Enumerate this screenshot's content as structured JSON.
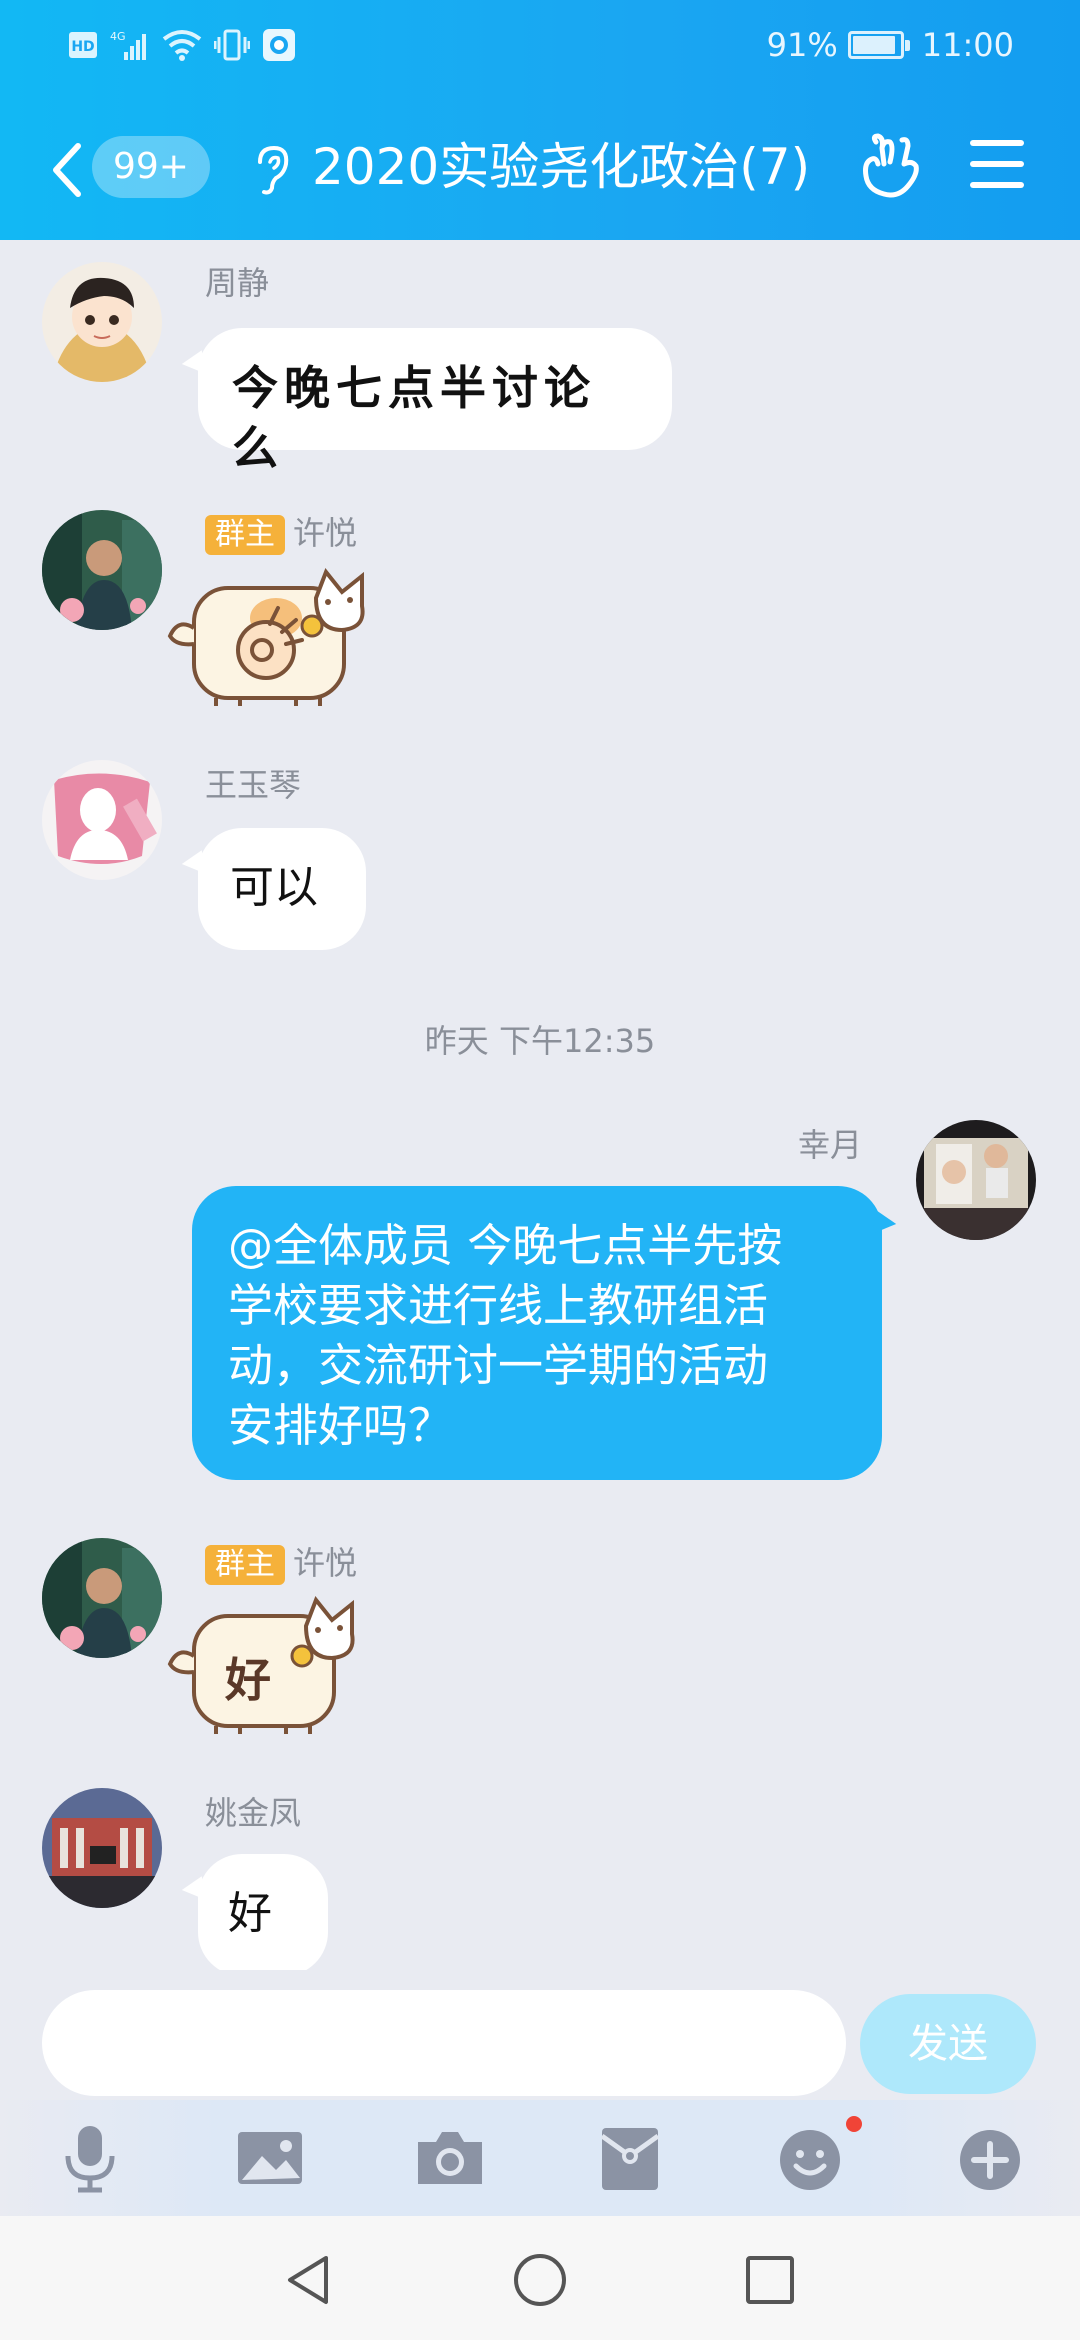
{
  "status_bar": {
    "left_icons": [
      "hd-icon",
      "4g-signal-icon",
      "wifi-icon",
      "vibrate-icon",
      "app-notification-icon"
    ],
    "hd_label": "HD",
    "network_label": "4G",
    "battery_percent": "91%",
    "time": "11:00"
  },
  "header": {
    "unread_badge": "99+",
    "title": "2020实验尧化政治(7)",
    "colors": {
      "gradient_start": "#12b8f4",
      "gradient_end": "#139df0"
    }
  },
  "messages": [
    {
      "sender": "周静",
      "text": "今晚七点半讨论么",
      "side": "left",
      "type": "text"
    },
    {
      "sender": "许悦",
      "badge": "群主",
      "side": "left",
      "type": "sticker",
      "sticker": "cat-ok-hand-sticker"
    },
    {
      "sender": "王玉琴",
      "text": "可以",
      "side": "left",
      "type": "text"
    },
    {
      "timestamp": "昨天 下午12:35"
    },
    {
      "sender": "幸月",
      "text": "@全体成员 今晚七点半先按学校要求进行线上教研组活动，交流研讨一学期的活动安排好吗？",
      "lines": [
        "@全体成员 今晚七点半先按",
        "学校要求进行线上教研组活",
        "动，交流研讨一学期的活动",
        "安排好吗？"
      ],
      "side": "right",
      "type": "text"
    },
    {
      "sender": "许悦",
      "badge": "群主",
      "side": "left",
      "type": "sticker",
      "sticker": "cat-hao-sticker",
      "sticker_text": "好"
    },
    {
      "sender": "姚金凤",
      "text": "好",
      "side": "left",
      "type": "text"
    }
  ],
  "input": {
    "placeholder": "",
    "send_label": "发送"
  },
  "toolbar": [
    "microphone-icon",
    "image-icon",
    "camera-icon",
    "red-packet-icon",
    "emoji-icon",
    "plus-icon"
  ],
  "system_nav": [
    "back-triangle-icon",
    "home-circle-icon",
    "recents-square-icon"
  ]
}
